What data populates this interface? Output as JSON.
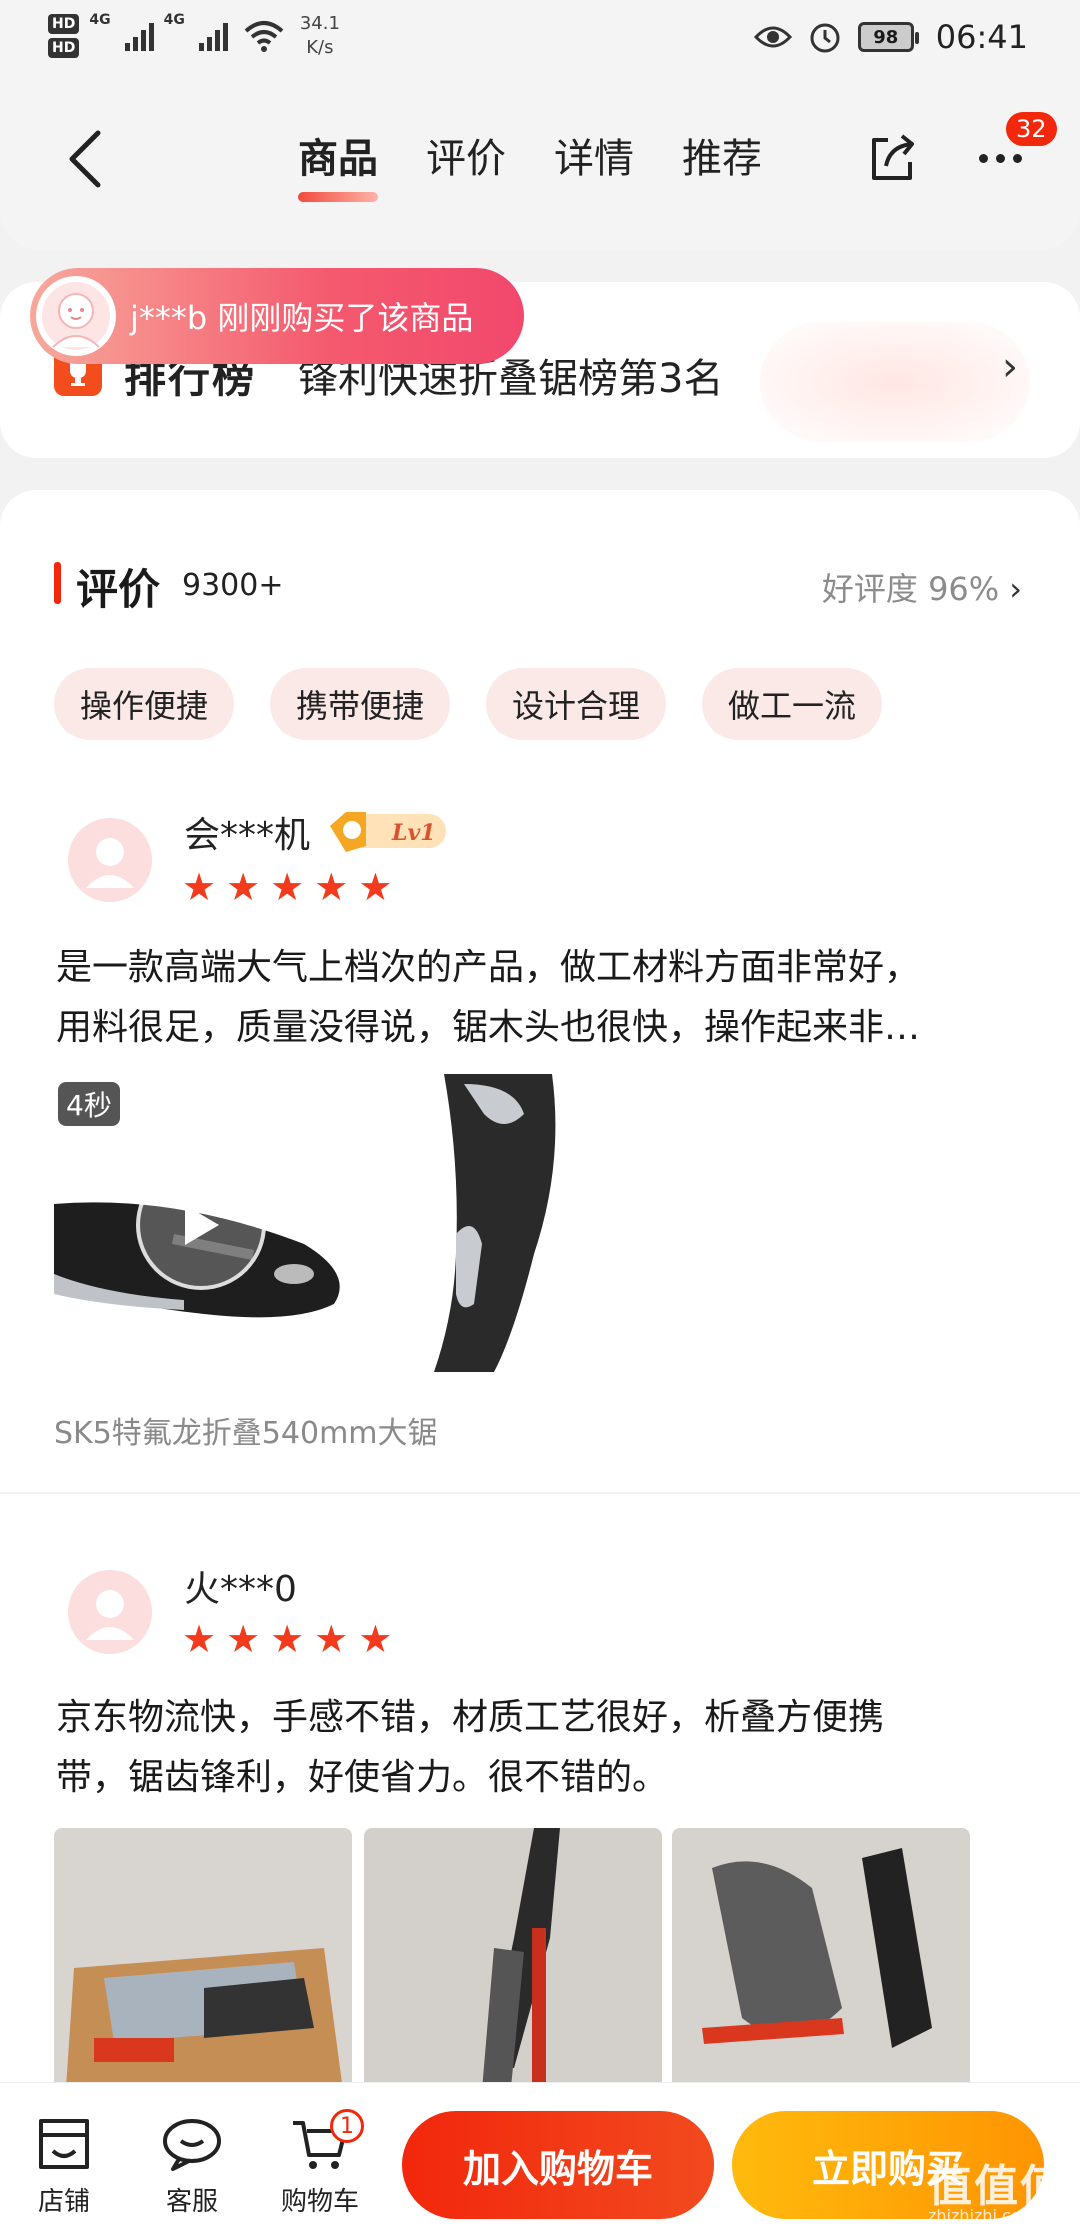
{
  "status_bar": {
    "hd1": "HD",
    "hd2": "HD",
    "sig1": "4G",
    "sig2": "4G",
    "net_speed_value": "34.1",
    "net_speed_unit": "K/s",
    "battery": "98",
    "time": "06:41"
  },
  "nav": {
    "tabs": [
      {
        "label": "商品",
        "active": true
      },
      {
        "label": "评价",
        "active": false
      },
      {
        "label": "详情",
        "active": false
      },
      {
        "label": "推荐",
        "active": false
      }
    ],
    "more_badge": "32"
  },
  "toast": {
    "text": "j***b 刚刚购买了该商品"
  },
  "ranking": {
    "label": "排行榜",
    "text": "锋利快速折叠锯榜第3名",
    "chevron": "›"
  },
  "reviews_section": {
    "title": "评价",
    "count": "9300+",
    "rating_label": "好评度 96%",
    "rating_chevron": "›",
    "tags": [
      "操作便捷",
      "携带便捷",
      "设计合理",
      "做工一流"
    ]
  },
  "reviews": [
    {
      "user": "会***机",
      "level": "Lv1",
      "stars": 5,
      "text_line1": "是一款高端大气上档次的产品，做工材料方面非常好，",
      "text_line2": "用料很足，质量没得说，锯木头也很快，操作起来非…",
      "video_duration": "4秒",
      "spec": "SK5特氟龙折叠540mm大锯"
    },
    {
      "user": "火***0",
      "stars": 5,
      "text_line1": "京东物流快，手感不错，材质工艺很好，析叠方便携",
      "text_line2": "带，锯齿锋利，好使省力。很不错的。"
    }
  ],
  "bottom_bar": {
    "shop_label": "店铺",
    "service_label": "客服",
    "cart_label": "购物车",
    "cart_badge": "1",
    "add_to_cart": "加入购物车",
    "buy_now": "立即购买"
  },
  "watermark": {
    "text": "值值值",
    "sub": "zhizhizhi.com"
  },
  "colors": {
    "accent_red": "#f2270c",
    "accent_orange": "#ff9402",
    "star": "#f33a1d",
    "tag_bg": "#fbe9e7"
  }
}
